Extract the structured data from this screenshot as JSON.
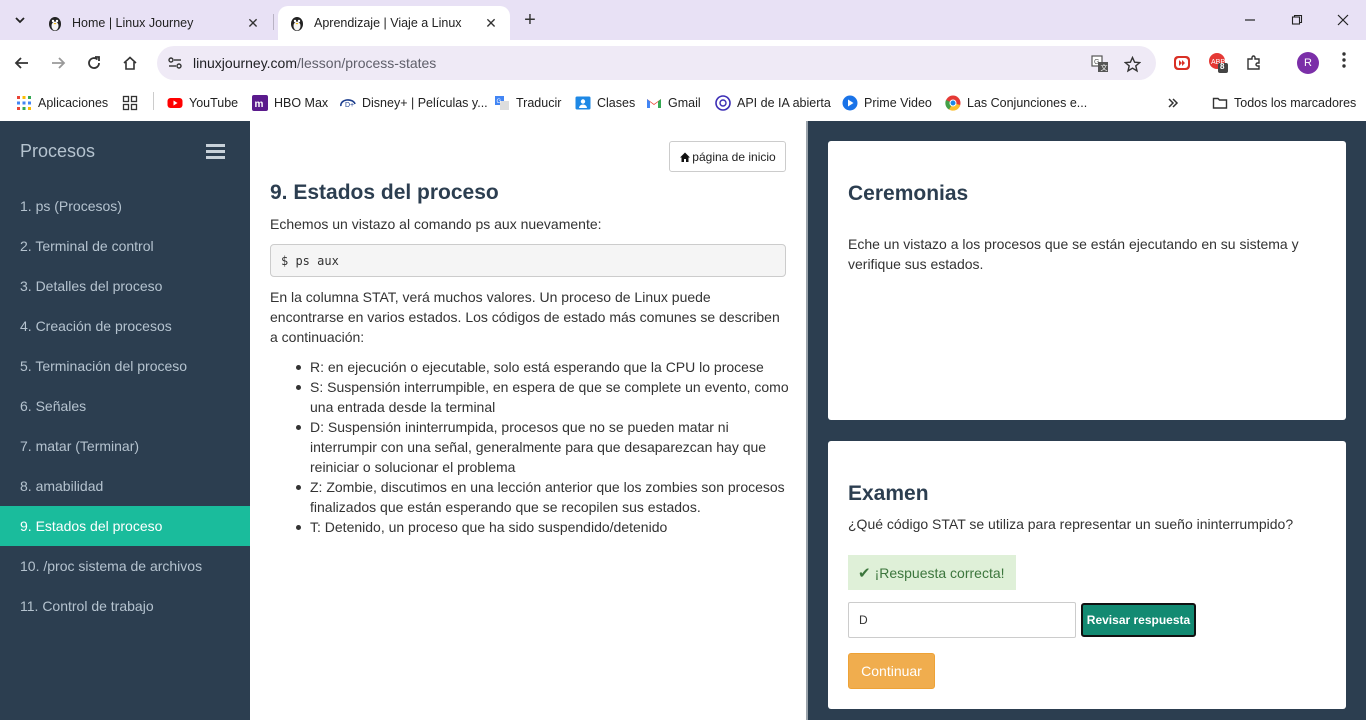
{
  "browser": {
    "tabs": [
      {
        "title": "Home | Linux Journey",
        "active": false
      },
      {
        "title": "Aprendizaje | Viaje a Linux",
        "active": true
      }
    ],
    "url_host": "linuxjourney.com",
    "url_path": "/lesson/process-states",
    "extension_badge": "8",
    "profile_initial": "R",
    "bookmarks": [
      {
        "label": "Aplicaciones",
        "icon": "apps-grid-icon"
      },
      {
        "label": "",
        "icon": "grid-icon"
      },
      {
        "label": "YouTube",
        "icon": "youtube-icon"
      },
      {
        "label": "HBO Max",
        "icon": "hbo-max-icon"
      },
      {
        "label": "Disney+ | Películas y...",
        "icon": "disney-plus-icon"
      },
      {
        "label": "Traducir",
        "icon": "translate-icon"
      },
      {
        "label": "Clases",
        "icon": "classroom-icon"
      },
      {
        "label": "Gmail",
        "icon": "gmail-icon"
      },
      {
        "label": "API de IA abierta",
        "icon": "openai-icon"
      },
      {
        "label": "Prime Video",
        "icon": "prime-video-icon"
      },
      {
        "label": "Las Conjunciones e...",
        "icon": "chrome-icon"
      }
    ],
    "all_bookmarks": "Todos los marcadores"
  },
  "sidebar": {
    "title": "Procesos",
    "items": [
      {
        "label": "1. ps (Procesos)",
        "active": false
      },
      {
        "label": "2. Terminal de control",
        "active": false
      },
      {
        "label": "3. Detalles del proceso",
        "active": false
      },
      {
        "label": "4. Creación de procesos",
        "active": false
      },
      {
        "label": "5. Terminación del proceso",
        "active": false
      },
      {
        "label": "6. Señales",
        "active": false
      },
      {
        "label": "7. matar (Terminar)",
        "active": false
      },
      {
        "label": "8. amabilidad",
        "active": false
      },
      {
        "label": "9. Estados del proceso",
        "active": true
      },
      {
        "label": "10. /proc sistema de archivos",
        "active": false
      },
      {
        "label": "11. Control de trabajo",
        "active": false
      }
    ]
  },
  "lesson": {
    "home_button": "página de inicio",
    "title": "9. Estados del proceso",
    "intro": "Echemos un vistazo al comando ps aux nuevamente:",
    "code": "$ ps aux",
    "paragraph": "En la columna STAT, verá muchos valores. Un proceso de Linux puede encontrarse en varios estados. Los códigos de estado más comunes se describen a continuación:",
    "states": [
      "R: en ejecución o ejecutable, solo está esperando que la CPU lo procese",
      "S: Suspensión interrumpible, en espera de que se complete un evento, como una entrada desde la terminal",
      "D: Suspensión ininterrumpida, procesos que no se pueden matar ni interrumpir con una señal, generalmente para que desaparezcan hay que reiniciar o solucionar el problema",
      "Z: Zombie, discutimos en una lección anterior que los zombies son procesos finalizados que están esperando que se recopilen sus estados.",
      "T: Detenido, un proceso que ha sido suspendido/detenido"
    ]
  },
  "exercise": {
    "title": "Ceremonias",
    "text": "Eche un vistazo a los procesos que se están ejecutando en su sistema y verifique sus estados."
  },
  "quiz": {
    "title": "Examen",
    "question": "¿Qué código STAT se utiliza para representar un sueño ininterrumpido?",
    "feedback": "¡Respuesta correcta!",
    "answer_value": "D",
    "check_label": "Revisar respuesta",
    "continue_label": "Continuar"
  },
  "colors": {
    "sidebar_bg": "#2c3e50",
    "active_item": "#1abc9c",
    "check_button": "#138a72",
    "continue_button": "#f0ad4e",
    "success_bg": "#dff0d8"
  }
}
